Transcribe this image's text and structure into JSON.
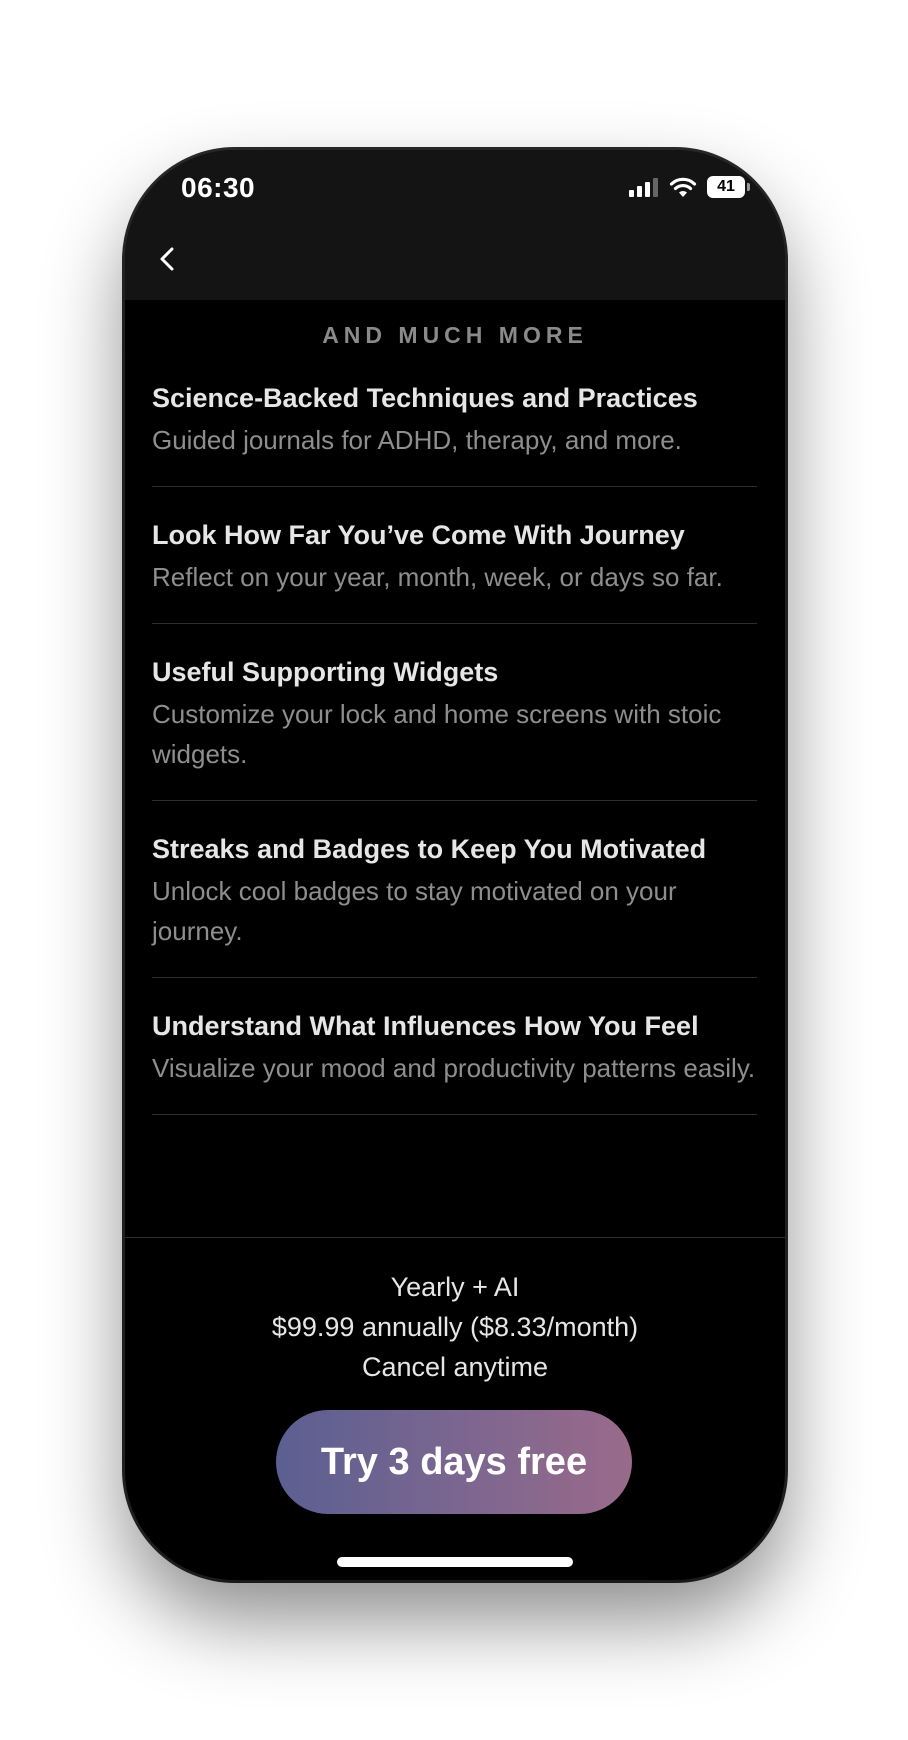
{
  "status_bar": {
    "time": "06:30",
    "battery": "41"
  },
  "section_title": "AND MUCH MORE",
  "features": [
    {
      "title": "Science-Backed Techniques and Practices",
      "description": "Guided journals for ADHD, therapy, and more."
    },
    {
      "title": "Look How Far You’ve Come With Journey",
      "description": "Reflect on your year, month, week, or days so far."
    },
    {
      "title": "Useful Supporting Widgets",
      "description": "Customize your lock and home screens with stoic widgets."
    },
    {
      "title": "Streaks and Badges to Keep You Motivated",
      "description": "Unlock cool badges to stay motivated on your journey."
    },
    {
      "title": "Understand What Influences How You Feel",
      "description": "Visualize your mood and productivity patterns easily."
    }
  ],
  "plan": {
    "name": "Yearly + AI",
    "price": "$99.99 annually ($8.33/month)",
    "note": "Cancel anytime"
  },
  "cta": {
    "label": "Try 3 days free"
  },
  "colors": {
    "background": "#000000",
    "header": "#141414",
    "cta_gradient_start": "#5b5f91",
    "cta_gradient_end": "#9a6a8a"
  },
  "icons": [
    "back-chevron-icon",
    "cellular-signal-icon",
    "wifi-icon",
    "battery-icon"
  ]
}
